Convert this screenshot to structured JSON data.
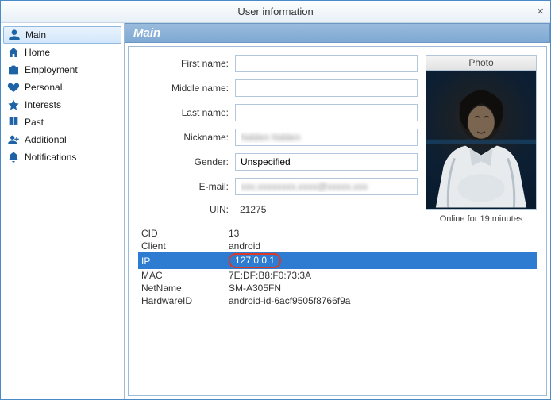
{
  "window": {
    "title": "User information",
    "close": "×"
  },
  "sidebar": {
    "items": [
      {
        "label": "Main"
      },
      {
        "label": "Home"
      },
      {
        "label": "Employment"
      },
      {
        "label": "Personal"
      },
      {
        "label": "Interests"
      },
      {
        "label": "Past"
      },
      {
        "label": "Additional"
      },
      {
        "label": "Notifications"
      }
    ]
  },
  "section": {
    "title": "Main"
  },
  "form": {
    "first_name_label": "First name:",
    "first_name": "",
    "middle_name_label": "Middle name:",
    "middle_name": "",
    "last_name_label": "Last name:",
    "last_name": "",
    "nickname_label": "Nickname:",
    "nickname": "hidden hidden",
    "gender_label": "Gender:",
    "gender": "Unspecified",
    "email_label": "E-mail:",
    "email": "xxx.xxxxxxxx.xxxx@xxxxx.xxx",
    "uin_label": "UIN:",
    "uin": "21275"
  },
  "photo": {
    "header": "Photo",
    "status": "Online for 19 minutes"
  },
  "info": {
    "rows": [
      {
        "k": "CID",
        "v": "13"
      },
      {
        "k": "Client",
        "v": "android"
      },
      {
        "k": "IP",
        "v": "127.0.0.1"
      },
      {
        "k": "MAC",
        "v": "7E:DF:B8:F0:73:3A"
      },
      {
        "k": "NetName",
        "v": "SM-A305FN"
      },
      {
        "k": "HardwareID",
        "v": "android-id-6acf9505f8766f9a"
      }
    ]
  }
}
